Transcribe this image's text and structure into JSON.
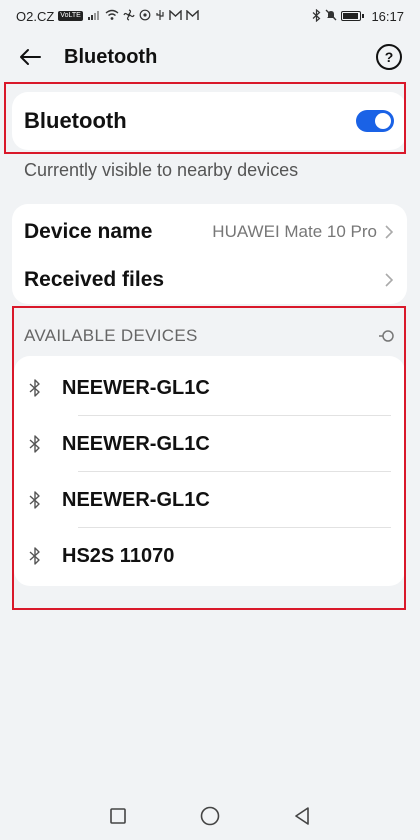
{
  "status_bar": {
    "carrier": "O2.CZ",
    "volte": "VoLTE",
    "signal": "4G",
    "time": "16:17",
    "battery_level": 0.9,
    "icons": [
      "signal-icon",
      "wifi-icon",
      "fan-icon",
      "whatsapp-icon",
      "usb-icon",
      "gmail-icon",
      "bluetooth-icon",
      "mute-icon",
      "battery-icon"
    ]
  },
  "app_bar": {
    "title": "Bluetooth",
    "help": "?"
  },
  "bluetooth_toggle": {
    "label": "Bluetooth",
    "enabled": true,
    "accent": "#1a62e6"
  },
  "visibility_note": "Currently visible to nearby devices",
  "info": {
    "device_name_label": "Device name",
    "device_name_value": "HUAWEI Mate 10 Pro",
    "received_files_label": "Received files"
  },
  "available": {
    "title": "AVAILABLE DEVICES",
    "devices": [
      {
        "name": "NEEWER-GL1C"
      },
      {
        "name": "NEEWER-GL1C"
      },
      {
        "name": "NEEWER-GL1C"
      },
      {
        "name": "HS2S 11070"
      }
    ]
  },
  "colors": {
    "highlight": "#d9182a",
    "background": "#f1f3f5"
  }
}
